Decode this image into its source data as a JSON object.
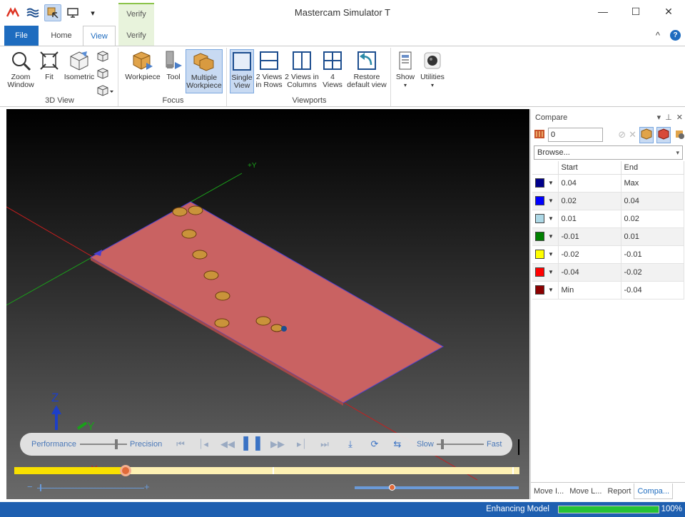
{
  "app": {
    "title": "Mastercam Simulator  T"
  },
  "qat": {
    "more": "▾"
  },
  "window": {
    "minimize": "—",
    "maximize": "☐",
    "close": "✕"
  },
  "tabs": {
    "context_group": "Verify",
    "items": [
      {
        "label": "File"
      },
      {
        "label": "Home"
      },
      {
        "label": "View"
      },
      {
        "label": "Verify"
      }
    ],
    "collapse": "^",
    "help": "?"
  },
  "ribbon": {
    "groups": {
      "view3d": "3D View",
      "focus": "Focus",
      "viewports": "Viewports"
    },
    "buttons": {
      "zoom_window": "Zoom Window",
      "fit": "Fit",
      "isometric": "Isometric",
      "workpiece": "Workpiece",
      "tool": "Tool",
      "multiple_workpiece": "Multiple Workpiece",
      "single_view": "Single View",
      "two_rows": "2 Views in Rows",
      "two_cols": "2 Views in Columns",
      "four_views": "4 Views",
      "restore": "Restore default view",
      "show": "Show",
      "utilities": "Utilities"
    }
  },
  "viewport": {
    "axis_plus_y": "+Y",
    "triad": {
      "z": "Z",
      "y": "Y",
      "x": "X"
    },
    "colors": {
      "workpiece": "#c96262",
      "edge": "#4a3fd0",
      "x_axis": "#c81e1e",
      "y_axis": "#1aa01a"
    }
  },
  "playback": {
    "performance": "Performance",
    "precision": "Precision",
    "slow": "Slow",
    "fast": "Fast",
    "precision_level": 0.78,
    "speed_level": 0.12,
    "progress": 0.22
  },
  "zoom": {
    "minus": "−",
    "plus": "+"
  },
  "compare": {
    "title": "Compare",
    "value": "0",
    "browse_placeholder": "Browse...",
    "headers": {
      "start": "Start",
      "end": "End"
    },
    "rows": [
      {
        "color": "#00008b",
        "start": "0.04",
        "end": "Max"
      },
      {
        "color": "#0000ff",
        "start": "0.02",
        "end": "0.04"
      },
      {
        "color": "#add8e6",
        "start": "0.01",
        "end": "0.02"
      },
      {
        "color": "#008000",
        "start": "-0.01",
        "end": "0.01"
      },
      {
        "color": "#ffff00",
        "start": "-0.02",
        "end": "-0.01"
      },
      {
        "color": "#ff0000",
        "start": "-0.04",
        "end": "-0.02"
      },
      {
        "color": "#8b0000",
        "start": "Min",
        "end": "-0.04"
      }
    ],
    "tabs": [
      {
        "label": "Move I..."
      },
      {
        "label": "Move L..."
      },
      {
        "label": "Report"
      },
      {
        "label": "Compa..."
      }
    ]
  },
  "status": {
    "text": "Enhancing Model",
    "percent": "100%",
    "progress": 1.0
  }
}
